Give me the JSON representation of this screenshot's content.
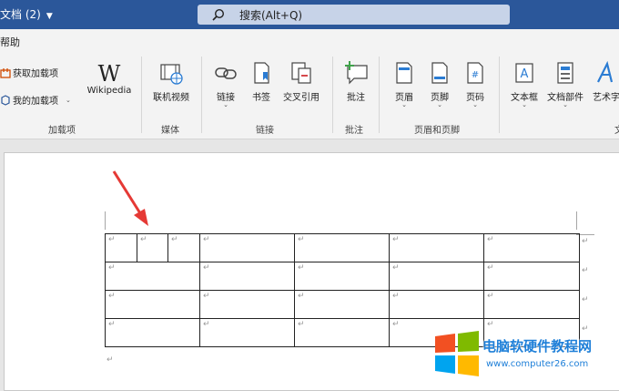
{
  "titlebar": {
    "doc_title": "文档 (2)",
    "search_placeholder": "搜索(Alt+Q)"
  },
  "menu": {
    "help": "帮助"
  },
  "ribbon": {
    "addins": {
      "get_addins": "获取加载项",
      "my_addins": "我的加载项",
      "wikipedia": "Wikipedia",
      "label": "加载项"
    },
    "media": {
      "online_video": "联机视频",
      "label": "媒体"
    },
    "links": {
      "link": "链接",
      "bookmark": "书签",
      "cross_ref": "交叉引用",
      "label": "链接"
    },
    "comments": {
      "comment": "批注",
      "label": "批注"
    },
    "header_footer": {
      "header": "页眉",
      "footer": "页脚",
      "page_number": "页码",
      "label": "页眉和页脚"
    },
    "text": {
      "textbox": "文本框",
      "doc_parts": "文档部件",
      "wordart": "艺术字",
      "label_partial": "文"
    }
  },
  "document": {
    "paragraph_mark": "↵"
  },
  "watermark": {
    "name": "电脑软硬件教程网",
    "url": "www.computer26.com"
  },
  "colors": {
    "titlebar": "#2b579a",
    "arrow": "#e53935",
    "logo_red": "#f25022",
    "logo_green": "#7fba00",
    "logo_blue": "#00a4ef",
    "logo_yellow": "#ffb900"
  }
}
